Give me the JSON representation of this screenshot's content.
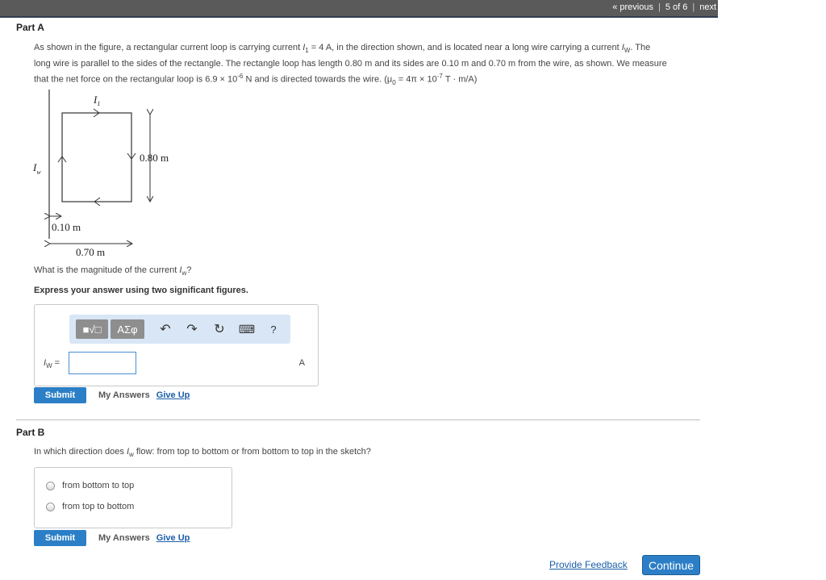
{
  "nav": {
    "previous": "« previous",
    "position": "5 of 6",
    "next": "next"
  },
  "part_a": {
    "title": "Part A",
    "problem_line1_pre": "As shown in the figure, a rectangular current loop is carrying current ",
    "problem_i1": "I",
    "problem_i1_sub": "1",
    "problem_line1_mid": " = 4 A, in the direction shown, and is located near a long wire carrying a current ",
    "problem_iw": "I",
    "problem_iw_sub": "W",
    "problem_line1_end": ". The",
    "problem_line2": "long wire is parallel to the sides of the rectangle. The rectangle loop has length 0.80 m and its sides are 0.10 m and 0.70 m from the wire, as shown. We measure",
    "problem_line3_pre": "that the net force on the rectangular loop is 6.9 × 10",
    "problem_line3_exp1": "-6",
    "problem_line3_mid": " N and is directed towards the wire. (μ",
    "problem_line3_mu_sub": "0",
    "problem_line3_mid2": " = 4π × 10",
    "problem_line3_exp2": "-7",
    "problem_line3_end": " T · m/A)",
    "figure": {
      "label_i1": "I",
      "label_i1_sub": "1",
      "label_iw": "I",
      "label_iw_sub": "w",
      "label_length": "0.80 m",
      "label_near": "0.10 m",
      "label_far": "0.70 m"
    },
    "question_pre": "What is the magnitude of the current ",
    "question_var": "I",
    "question_sub": "w",
    "question_end": "?",
    "instruction": "Express your answer using two significant figures.",
    "toolbar": {
      "template_label": "■√□",
      "greek_label": "ΑΣφ",
      "undo_icon": "↶",
      "redo_icon": "↷",
      "reset_icon": "↻",
      "keyboard_icon": "⌨",
      "help_label": "?"
    },
    "input_label": "I",
    "input_label_sub": "W",
    "input_label_eq": " =",
    "input_value": "",
    "unit": "A",
    "submit": "Submit",
    "my_answers": "My Answers",
    "give_up": "Give Up"
  },
  "part_b": {
    "title": "Part B",
    "question_pre": "In which direction does ",
    "question_var": "I",
    "question_sub": "w",
    "question_end": " flow: from top to bottom or from bottom to top in the sketch?",
    "options": [
      "from bottom to top",
      "from top to bottom"
    ],
    "submit": "Submit",
    "my_answers": "My Answers",
    "give_up": "Give Up"
  },
  "footer": {
    "feedback": "Provide Feedback",
    "continue": "Continue"
  }
}
